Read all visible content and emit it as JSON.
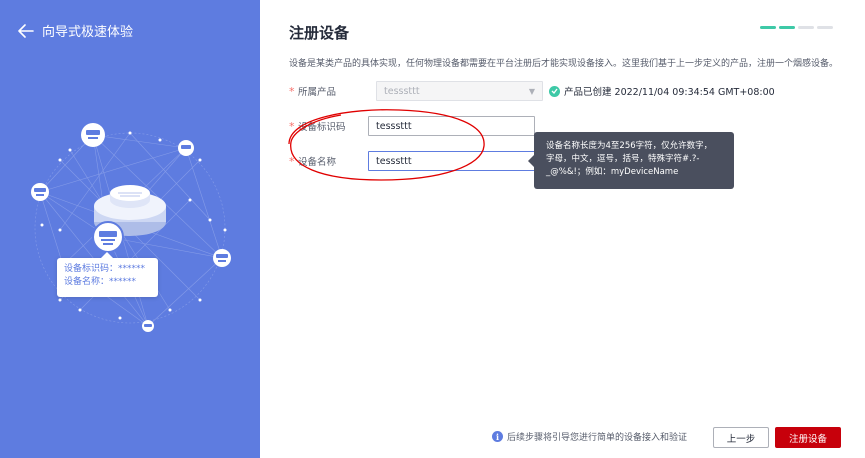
{
  "sidebar": {
    "back_title": "向导式极速体验",
    "card": {
      "line1": "设备标识码：******",
      "line2": "设备名称：******"
    }
  },
  "main": {
    "title": "注册设备",
    "description": "设备是某类产品的具体实现，任何物理设备都需要在平台注册后才能实现设备接入。这里我们基于上一步定义的产品，注册一个烟感设备。",
    "steps": [
      true,
      true,
      false,
      false
    ],
    "form": {
      "product": {
        "label": "所属产品",
        "value": "tesssttt",
        "created_text": "产品已创建 2022/11/04 09:34:54 GMT+08:00"
      },
      "device_id": {
        "label": "设备标识码",
        "value": "tesssttt"
      },
      "device_name": {
        "label": "设备名称",
        "value": "tesssttt"
      }
    },
    "tooltip": {
      "line1": "设备名称长度为4至256字符，仅允许数字，",
      "line2": "字母，中文，逗号，括号，特殊字符#.?-",
      "line3": "_@%&!；例如：myDeviceName"
    }
  },
  "footer": {
    "info": "后续步骤将引导您进行简单的设备接入和验证",
    "prev_label": "上一步",
    "next_label": "注册设备"
  },
  "colors": {
    "sidebar_bg": "#5e7ce0",
    "primary_button": "#c7000b",
    "success": "#3ec9a7",
    "annotation": "#e00000"
  }
}
